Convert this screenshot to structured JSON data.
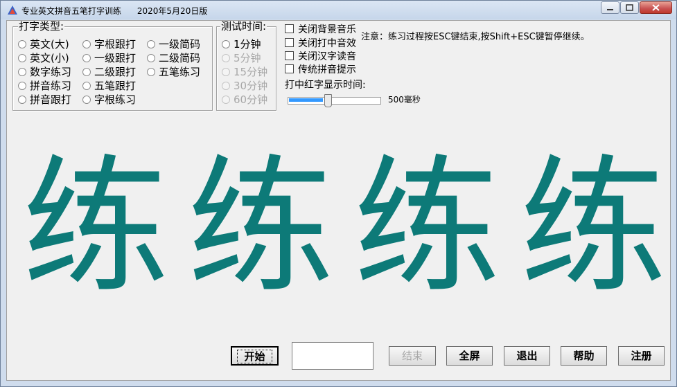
{
  "window": {
    "title": "专业英文拼音五笔打字训练      2020年5月20日版"
  },
  "typing_type": {
    "legend": "打字类型:",
    "options": [
      {
        "label": "英文(大)"
      },
      {
        "label": "字根跟打"
      },
      {
        "label": "一级简码"
      },
      {
        "label": "英文(小)"
      },
      {
        "label": "一级跟打"
      },
      {
        "label": "二级简码"
      },
      {
        "label": "数字练习"
      },
      {
        "label": "二级跟打"
      },
      {
        "label": "五笔练习"
      },
      {
        "label": "拼音练习"
      },
      {
        "label": "五笔跟打"
      },
      {
        "label": "拼音跟打"
      },
      {
        "label": "字根练习"
      }
    ]
  },
  "test_time": {
    "legend": "测试时间:",
    "options": [
      {
        "label": "1分钟",
        "enabled": true
      },
      {
        "label": "5分钟",
        "enabled": false
      },
      {
        "label": "15分钟",
        "enabled": false
      },
      {
        "label": "30分钟",
        "enabled": false
      },
      {
        "label": "60分钟",
        "enabled": false
      }
    ]
  },
  "options": {
    "close_bg_music": "关闭背景音乐",
    "close_hit_sound": "关闭打中音效",
    "close_char_reading": "关闭汉字读音",
    "traditional_pinyin_hint": "传统拼音提示",
    "red_char_display_time_label": "打中红字显示时间:",
    "notice": "注意：练习过程按ESC键结束,按Shift+ESC键暂停继续。"
  },
  "slider": {
    "value_label": "500毫秒",
    "level_fraction": 0.43
  },
  "practice": {
    "chars": [
      "练",
      "练",
      "练",
      "练"
    ],
    "char_color": "#0d7a78"
  },
  "buttons": {
    "start": "开始",
    "end": "结束",
    "fullscreen": "全屏",
    "exit": "退出",
    "help": "帮助",
    "register": "注册"
  }
}
